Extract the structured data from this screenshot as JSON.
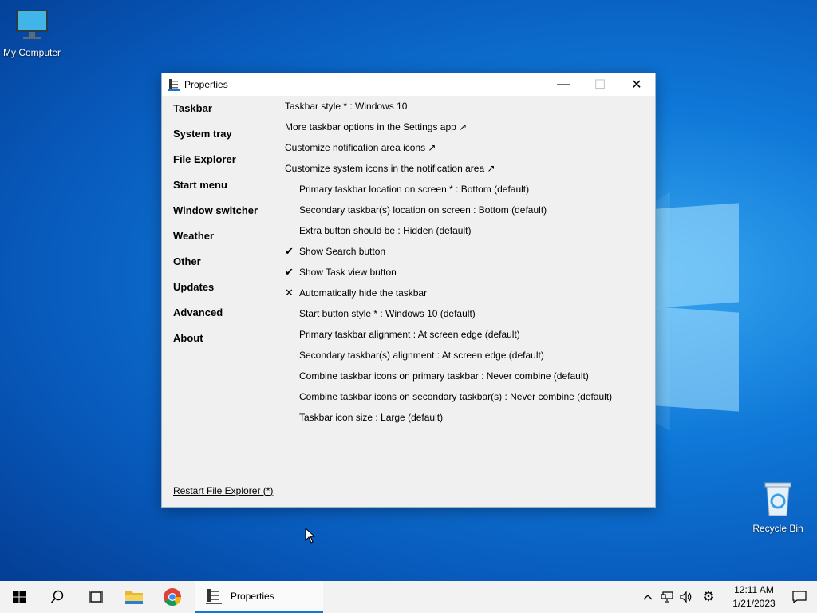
{
  "desktop": {
    "icons": [
      {
        "label": "My Computer",
        "icon": "monitor-icon"
      },
      {
        "label": "Recycle Bin",
        "icon": "recycle-bin-icon"
      }
    ]
  },
  "window": {
    "title": "Properties",
    "controls": {
      "minimize": "—",
      "maximize": "☐",
      "close": "✕"
    },
    "sidebar": {
      "active": "Taskbar",
      "items": [
        "Taskbar",
        "System tray",
        "File Explorer",
        "Start menu",
        "Window switcher",
        "Weather",
        "Other",
        "Updates",
        "Advanced",
        "About"
      ]
    },
    "settings": [
      {
        "text": "Taskbar style * : Windows 10",
        "mark": "",
        "indent": false
      },
      {
        "text": "More taskbar options in the Settings app ↗",
        "mark": "",
        "indent": false
      },
      {
        "text": "Customize notification area icons ↗",
        "mark": "",
        "indent": false
      },
      {
        "text": "Customize system icons in the notification area ↗",
        "mark": "",
        "indent": false
      },
      {
        "text": "Primary taskbar location on screen * : Bottom (default)",
        "mark": "",
        "indent": true
      },
      {
        "text": "Secondary taskbar(s) location on screen : Bottom (default)",
        "mark": "",
        "indent": true
      },
      {
        "text": "Extra button should be : Hidden (default)",
        "mark": "",
        "indent": true
      },
      {
        "text": "Show Search button",
        "mark": "✔",
        "indent": true
      },
      {
        "text": "Show Task view button",
        "mark": "✔",
        "indent": true
      },
      {
        "text": "Automatically hide the taskbar",
        "mark": "✕",
        "indent": true
      },
      {
        "text": "Start button style * : Windows 10 (default)",
        "mark": "",
        "indent": true
      },
      {
        "text": "Primary taskbar alignment : At screen edge (default)",
        "mark": "",
        "indent": true
      },
      {
        "text": "Secondary taskbar(s) alignment : At screen edge (default)",
        "mark": "",
        "indent": true
      },
      {
        "text": "Combine taskbar icons on primary taskbar : Never combine (default)",
        "mark": "",
        "indent": true
      },
      {
        "text": "Combine taskbar icons on secondary taskbar(s) : Never combine (default)",
        "mark": "",
        "indent": true
      },
      {
        "text": "Taskbar icon size : Large (default)",
        "mark": "",
        "indent": true
      }
    ],
    "restart_link": "Restart File Explorer (*)"
  },
  "taskbar": {
    "running_app": "Properties",
    "clock": {
      "time": "12:11 AM",
      "date": "1/21/2023"
    }
  },
  "colors": {
    "accent": "#0f78d8",
    "window_bg": "#f0f0f0",
    "taskbar_bg": "#f2f2f2"
  }
}
